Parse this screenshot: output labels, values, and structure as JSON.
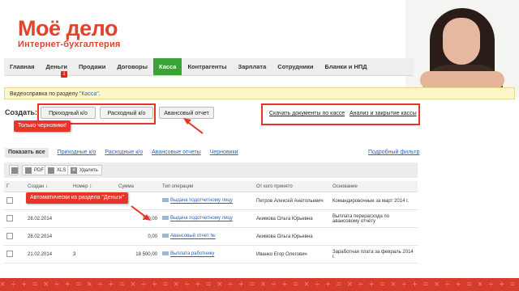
{
  "logo": {
    "title": "Моё дело",
    "subtitle": "Интернет-бухгалтерия"
  },
  "nav": {
    "items": [
      "Главная",
      "Деньги",
      "Продажи",
      "Договоры",
      "Касса",
      "Контрагенты",
      "Зарплата",
      "Сотрудники",
      "Бланки и НПД"
    ],
    "active": "Касса",
    "money_badge": "1"
  },
  "help": {
    "prefix": "Видеосправка по разделу ",
    "link": "\"Касса\"",
    "suffix": "."
  },
  "create": {
    "label": "Создать:",
    "incoming": "Приходный к/о",
    "outgoing": "Расходный к/о",
    "advance": "Авансовый отчет"
  },
  "callouts": {
    "drafts": "Только черновики!",
    "auto": "Автоматически из раздела \"Деньги\""
  },
  "links": {
    "download": "Скачать документы по кассе",
    "analysis": "Анализ и закрытие кассы"
  },
  "filters": {
    "show_all": "Показать все",
    "incoming": "Приходные к/о",
    "outgoing": "Расходные к/о",
    "advance": "Авансовые отчеты",
    "drafts": "Черновики",
    "detailed": "Подробный фильтр"
  },
  "toolbar": {
    "pdf": "PDF",
    "xls": "XLS",
    "delete": "Удалить"
  },
  "table": {
    "headers": [
      "Г",
      "Создан ↓",
      "Номер ↕",
      "Сумма",
      "Тип операции",
      "От кого принято",
      "Основание"
    ],
    "rows": [
      {
        "date": "",
        "number": "",
        "amount": "",
        "type": "Выдача подотчетному лицу",
        "from": "Петров Алексей Анатольевич",
        "basis": "Командировочные за март 2014 г."
      },
      {
        "date": "28.02.2014",
        "number": "",
        "amount": "300,00",
        "type": "Выдача подотчетному лицу",
        "from": "Акимова Ольга Юрьевна",
        "basis": "Выплата перерасхода по авансовому отчёту"
      },
      {
        "date": "28.02.2014",
        "number": "",
        "amount": "0,00",
        "type": "Авансовый отчет №",
        "from": "Акимова Ольга Юрьевна",
        "basis": ""
      },
      {
        "date": "21.02.2014",
        "number": "3",
        "amount": "18 500,00",
        "type": "Выплата работнику",
        "from": "Иванко Егор Олегович",
        "basis": "Заработная плата за февраль 2014 г."
      }
    ]
  },
  "colors": {
    "accent_red": "#e53524",
    "nav_active": "#3aa335",
    "link_blue": "#2a63b8"
  }
}
